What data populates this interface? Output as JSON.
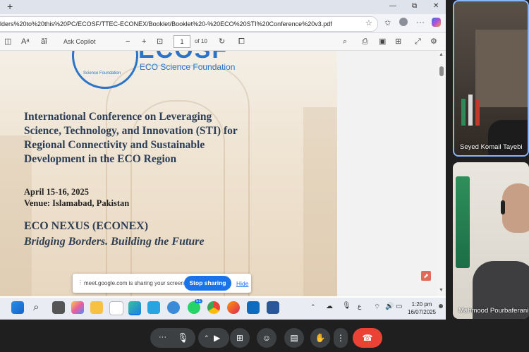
{
  "browser": {
    "new_tab_symbol": "+",
    "window_buttons": [
      "—",
      "⧉",
      "✕"
    ],
    "url": "lders%20to%20this%20PC/ECOSF/TTEC-ECONEX/Booklet/Booklet%20-%20ECO%20STI%20Conference%20v3.pdf"
  },
  "pdf_toolbar": {
    "ask_copilot": "Ask Copilot",
    "zoom_out": "−",
    "zoom_in": "+",
    "page_number": "1",
    "page_total": "of 10"
  },
  "document": {
    "logo_text": "ECOSF",
    "logo_ring_text": "Science Foundation",
    "org_name": "ECO Science Foundation",
    "title_lines": [
      "International Conference on Leveraging",
      "Science, Technology, and Innovation (STI) for",
      "Regional Connectivity and Sustainable",
      "Development in the ECO Region"
    ],
    "date": "April 15-16, 2025",
    "venue": "Venue: Islamabad, Pakistan",
    "nexus": "ECO NEXUS (ECONEX)",
    "tagline": "Bridging Borders. Building the Future"
  },
  "share_banner": {
    "message": "meet.google.com is sharing your screen.",
    "stop_label": "Stop sharing",
    "hide_label": "Hide"
  },
  "taskbar": {
    "time": "1:20 pm",
    "date": "16/07/2025",
    "badge": "51"
  },
  "participants": [
    {
      "name": "Seyed Komail Tayebi"
    },
    {
      "name": "Mahmood Pourbaferani"
    }
  ],
  "meet_controls": {
    "more_symbol": "···"
  },
  "colors": {
    "title": "#2e3f55",
    "logo_blue": "#2b74c9",
    "stop_button": "#1a73e8",
    "end_call": "#ea4335"
  }
}
